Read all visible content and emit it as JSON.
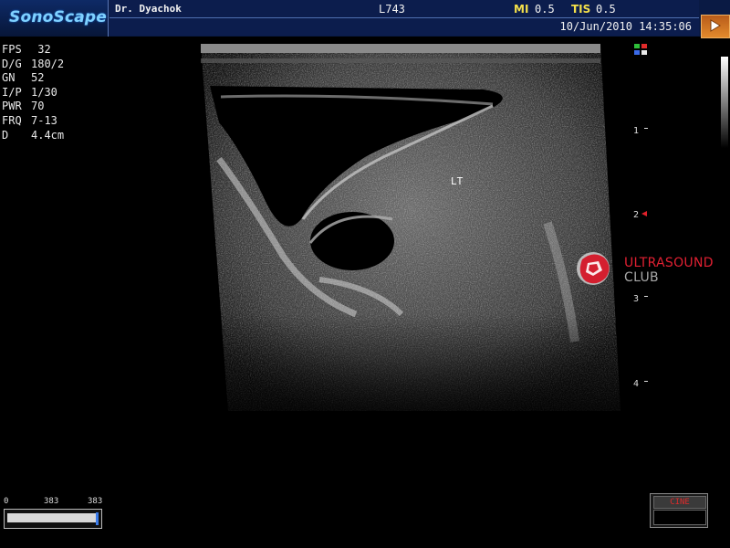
{
  "header": {
    "brand": "SonoScape",
    "doctor": "Dr. Dyachok",
    "probe": "L743",
    "mi_label": "MI",
    "mi_value": "0.5",
    "tis_label": "TIS",
    "tis_value": "0.5",
    "datetime": "10/Jun/2010 14:35:06"
  },
  "params": [
    {
      "key": "FPS",
      "value": " 32"
    },
    {
      "key": "D/G",
      "value": "180/2"
    },
    {
      "key": "GN",
      "value": "52"
    },
    {
      "key": "I/P",
      "value": "1/30"
    },
    {
      "key": "PWR",
      "value": "70"
    },
    {
      "key": "FRQ",
      "value": "7-13"
    },
    {
      "key": "D",
      "value": "4.4cm"
    }
  ],
  "scan": {
    "annotation": "LT"
  },
  "depth_scale": {
    "ticks": [
      "1",
      "2",
      "3",
      "4"
    ],
    "focus_color": "#e0202a"
  },
  "watermark": {
    "line1": "ULTRASOUND",
    "line2": "CLUB",
    "color_red": "#e02032",
    "color_gray": "#a8a8a8"
  },
  "cine": {
    "start": "0",
    "current": "383",
    "end": "383",
    "position_fraction": 1.0,
    "label": "CINE"
  },
  "colors": {
    "header_bg": "#0a1a44",
    "brand_cyan": "#7fd1ff",
    "highlight_yellow": "#f4e04a"
  }
}
